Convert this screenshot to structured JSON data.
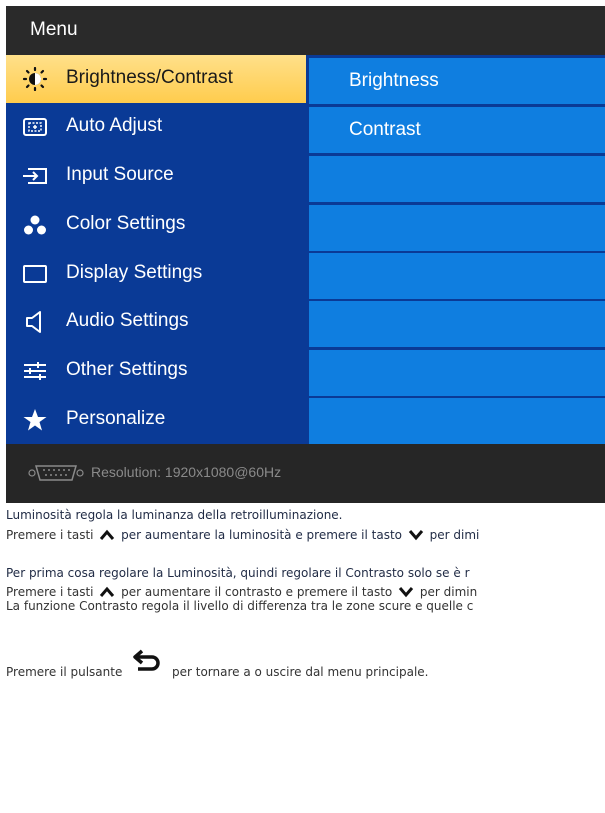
{
  "osd": {
    "title": "Menu",
    "menu_items": [
      {
        "label": "Brightness/Contrast",
        "icon": "brightness-icon",
        "selected": true
      },
      {
        "label": "Auto Adjust",
        "icon": "auto-adjust-icon"
      },
      {
        "label": "Input Source",
        "icon": "input-source-icon"
      },
      {
        "label": "Color Settings",
        "icon": "color-settings-icon"
      },
      {
        "label": "Display Settings",
        "icon": "display-settings-icon"
      },
      {
        "label": "Audio Settings",
        "icon": "speaker-icon"
      },
      {
        "label": "Other Settings",
        "icon": "sliders-icon"
      },
      {
        "label": "Personalize",
        "icon": "star-icon"
      }
    ],
    "sub_items": [
      "Brightness",
      "Contrast",
      "",
      "",
      "",
      "",
      "",
      ""
    ],
    "footer": {
      "resolution": "Resolution:  1920x1080@60Hz",
      "icon": "vga-connector-icon"
    },
    "colors": {
      "panel": "#0a3a96",
      "subitem": "#0f7ee0",
      "selected": "#ffd46a"
    }
  },
  "text": {
    "p1_line1": "Luminosità regola la luminanza della retroilluminazione.",
    "p1_line2_a": "Premere i tasti",
    "p1_line2_b": "per aumentare la luminosità e premere il tasto",
    "p1_line2_c": "per dimi",
    "p2_line1": "Per prima cosa regolare la Luminosità, quindi regolare il Contrasto solo se è r",
    "p2_line2_a": "Premere i tasti",
    "p2_line2_b": "per aumentare il contrasto e premere il tasto",
    "p2_line2_c": "per dimin",
    "p2_line3": "La funzione Contrasto regola il livello di differenza tra le zone scure e quelle c",
    "p3_a": "Premere il pulsante",
    "p3_b": "per tornare a o uscire dal menu principale."
  }
}
